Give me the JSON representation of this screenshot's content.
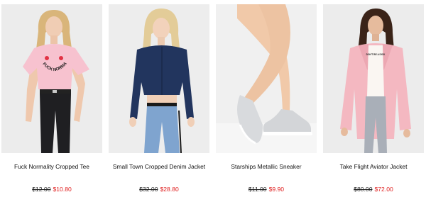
{
  "products": [
    {
      "name": "Fuck Normality Cropped Tee",
      "old_price": "$12.00",
      "new_price": "$10.80",
      "shirt_print": "FUCK NORMALITY",
      "image_icon": "model-pink-tee-photo"
    },
    {
      "name": "Small Town Cropped Denim Jacket",
      "old_price": "$32.00",
      "new_price": "$28.80",
      "image_icon": "model-denim-jacket-photo"
    },
    {
      "name": "Starships Metallic Sneaker",
      "old_price": "$11.00",
      "new_price": "$9.90",
      "image_icon": "silver-sneakers-photo"
    },
    {
      "name": "Take Flight Aviator Jacket",
      "old_price": "$80.00",
      "new_price": "$72.00",
      "shirt_print": "DON'T BE A DICK",
      "image_icon": "model-pink-aviator-photo"
    }
  ],
  "colors": {
    "sale_price": "#e02020",
    "old_price": "#222222",
    "image_bg": "#eeeeee"
  }
}
